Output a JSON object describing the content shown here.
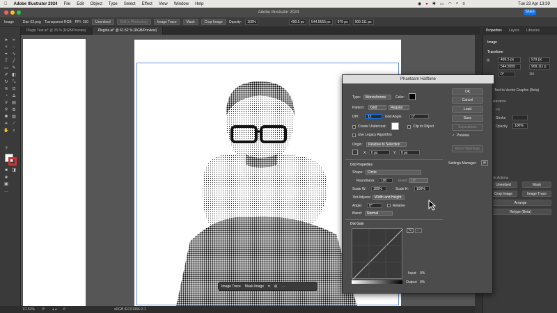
{
  "macbar": {
    "apple": "",
    "app": "Adobe Illustrator 2024",
    "menus": [
      "File",
      "Edit",
      "Object",
      "Type",
      "Select",
      "Effect",
      "View",
      "Window",
      "Help"
    ],
    "clock": "Tue 23 Apr  13:39"
  },
  "title": {
    "text": "Adobe Illustrator 2024",
    "share": "Share"
  },
  "control": {
    "type": "Image",
    "file": "Dan 02.png",
    "transparency": "Transparent RGB",
    "ppi": "PPI: 150",
    "unembed": "Unembed",
    "edit_photoshop": "Edit in Photoshop",
    "image_trace": "Image Trace",
    "mask": "Mask",
    "crop": "Crop Image",
    "opacity_label": "Opacity:",
    "opacity": "100%",
    "x": "499.5 px",
    "y": "544.5555 px",
    "w": "979 px",
    "h": "909.111 px"
  },
  "tabs": [
    {
      "label": "Plugin Test.ai* @ 25 % (RGB/Preview)",
      "active": false
    },
    {
      "label": "Plugins.ai* @ 61.52 % (RGB/Preview)",
      "active": true
    }
  ],
  "status": {
    "zoom": "61.52%",
    "angle": "0°",
    "artboard": "6",
    "mode": "sRGB IEC61966-2.1"
  },
  "context": {
    "trace": "Image Trace",
    "mask": "Mask Image"
  },
  "panel": {
    "tabs": [
      "Properties",
      "Layers",
      "Libraries"
    ],
    "kind": "Image",
    "transform": "Transform",
    "x": "499.5 px",
    "y": "544.5555",
    "w": "979 px",
    "h": "909.111 p",
    "rot": "0°",
    "scale": "1/4",
    "vector": "Text to Vector Graphic (Beta)",
    "appearance": "Appearance",
    "fill": "Fill",
    "stroke": "Stroke",
    "opacity": "Opacity",
    "opacity_val": "100%",
    "quick": "Quick Actions",
    "unembed": "Unembed",
    "mask": "Mask",
    "crop": "Crop Image",
    "trace": "Image Trace",
    "arrange": "Arrange",
    "retype": "Retype (Beta)"
  },
  "dialog": {
    "title": "Phantasm Halftone",
    "type_label": "Type:",
    "type": "Monochrome",
    "color_label": "Color:",
    "pattern_label": "Pattern:",
    "pattern": "Grid",
    "pattern2": "Regular",
    "dpi_label": "DPI:",
    "dpi": "12",
    "grid_angle_label": "Grid Angle:",
    "grid_angle": "0°",
    "undercoat": "Create Undercoat:",
    "clip": "Clip to Object",
    "legacy": "Use Legacy Algorithm",
    "origin_label": "Origin:",
    "origin": "Relative to Selection",
    "ox_label": "X:",
    "ox": "0 px",
    "oy_label": "Y:",
    "oy": "0 px",
    "dot_props": "Dot Properties",
    "shape_label": "Shape:",
    "shape": "Circle",
    "round_label": "Roundness:",
    "round": "100",
    "invert_label": "Invert:",
    "invert": "Off",
    "sw_label": "Scale W:",
    "sw": "100%",
    "sh_label": "Scale H:",
    "sh": "100%",
    "tint_label": "Tint Adjusts:",
    "tint": "Width and Height",
    "angle_label": "Angle:",
    "angle": "0°",
    "relative": "Relative",
    "blend_label": "Blend:",
    "blend": "Normal",
    "dot_gain": "Dot Gain",
    "input_label": "Input:",
    "input": "0%",
    "output_label": "Output:",
    "output": "0%",
    "ok": "OK",
    "cancel": "Cancel",
    "load": "Load",
    "save": "Save",
    "separations": "Separations",
    "preview": "Preview",
    "reset": "Reset Warnings",
    "settings": "Settings Manager:"
  }
}
